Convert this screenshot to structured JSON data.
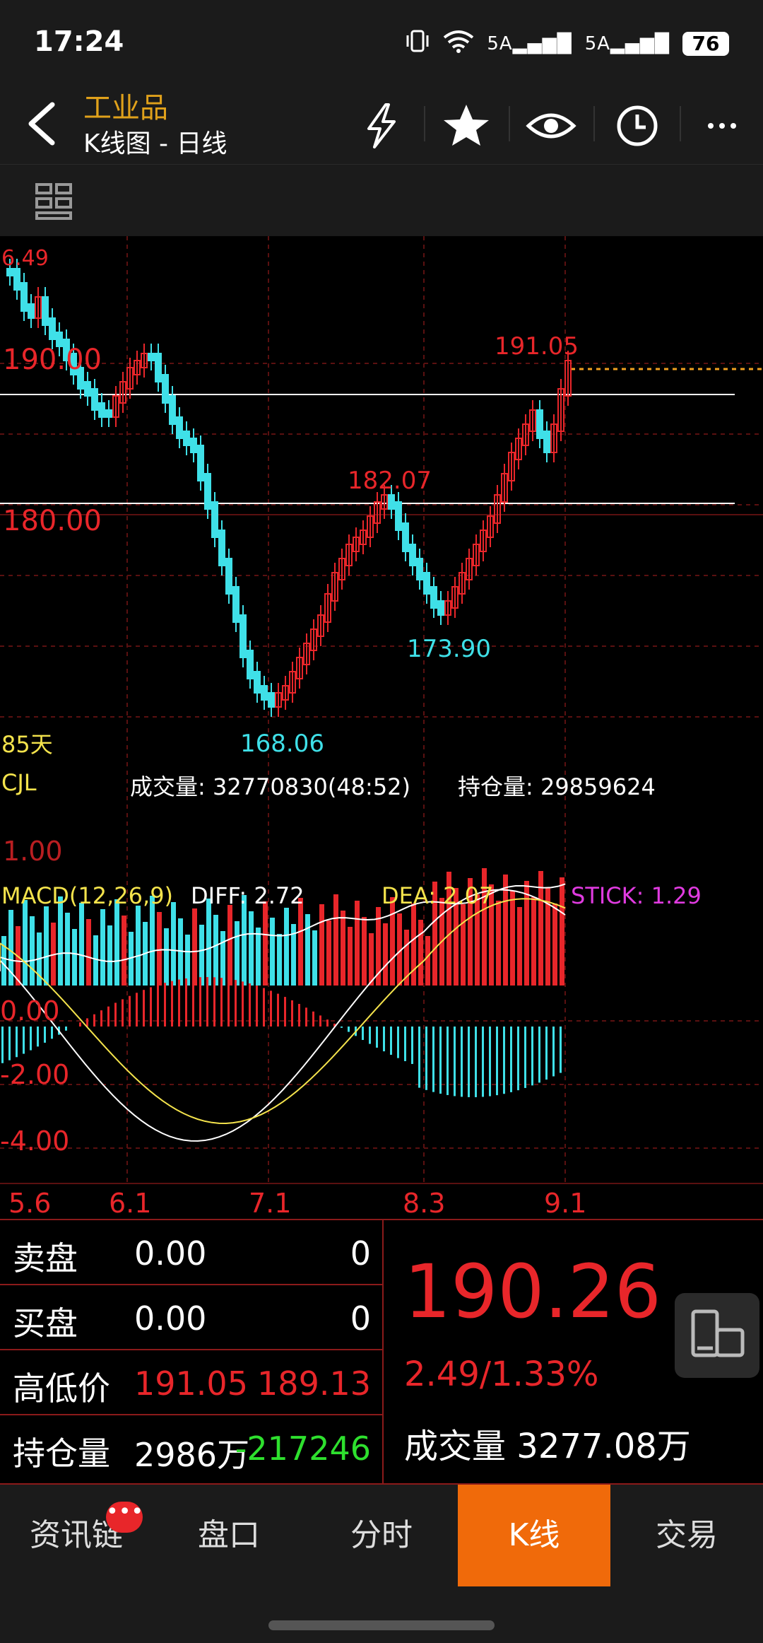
{
  "status": {
    "time": "17:24",
    "signal1": "5A",
    "signal2": "5A",
    "battery": "76"
  },
  "header": {
    "title": "工业品",
    "subtitle": "K线图 - 日线"
  },
  "chart": {
    "price_labels": {
      "top": "6.49",
      "level_190": "190.00",
      "level_180": "180.00",
      "high": "191.05",
      "peak": "182.07",
      "low1": "168.06",
      "low2": "173.90"
    },
    "period": "85天",
    "volume_label": "CJL",
    "volume_text": "成交量: 32770830(48:52)",
    "oi_text": "持仓量: 29859624",
    "vol_axis": "1.00",
    "macd_label": "MACD(12,26,9)",
    "diff_text": "DIFF: 2.72",
    "dea_text": "DEA: 2.07",
    "stick_text": "STICK: 1.29",
    "macd_axis": [
      "0.00",
      "-2.00",
      "-4.00"
    ],
    "date_ticks": [
      "5.6",
      "6.1",
      "7.1",
      "8.3",
      "9.1"
    ],
    "colors": {
      "up": "#e8262a",
      "down": "#3fe0e8",
      "dea": "#f4e34c",
      "accent": "#f06a0a"
    }
  },
  "quote": {
    "sell_label": "卖盘",
    "sell_price": "0.00",
    "sell_qty": "0",
    "buy_label": "买盘",
    "buy_price": "0.00",
    "buy_qty": "0",
    "hl_label": "高低价",
    "high": "191.05",
    "low": "189.13",
    "oi_label": "持仓量",
    "oi_value": "2986万",
    "oi_change": "-217246",
    "price": "190.26",
    "change": "2.49/1.33%",
    "volume_label": "成交量",
    "volume_value": "3277.08万"
  },
  "nav": {
    "tabs": [
      "资讯链",
      "盘口",
      "分时",
      "K线",
      "交易"
    ],
    "active": 3,
    "badge": "•••"
  }
}
